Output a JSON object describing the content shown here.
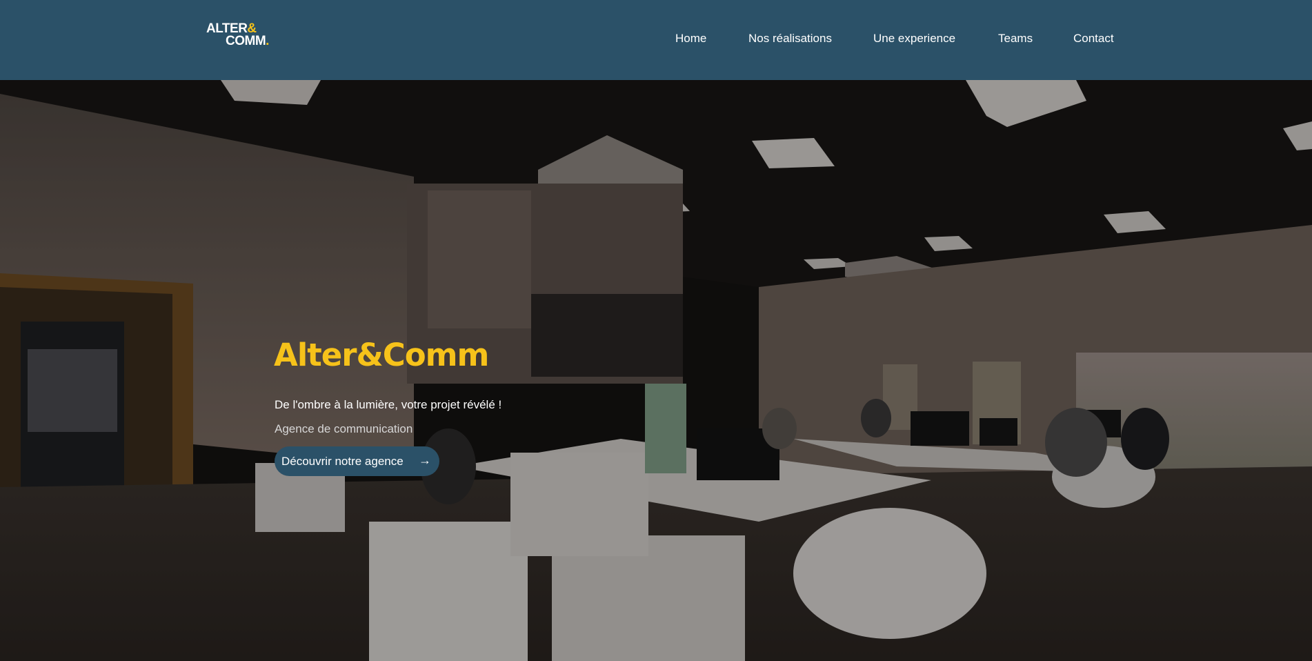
{
  "logo": {
    "line1": "ALTER",
    "amp": "&",
    "line2": "COMM",
    "dot": "."
  },
  "nav": {
    "items": [
      {
        "label": "Home"
      },
      {
        "label": "Nos réalisations"
      },
      {
        "label": "Une experience"
      },
      {
        "label": "Teams"
      },
      {
        "label": "Contact"
      }
    ]
  },
  "hero": {
    "title": "Alter&Comm",
    "tagline": "De l'ombre à la lumière, votre projet révélé !",
    "subtitle": "Agence de communication",
    "cta_label": "Découvrir notre agence",
    "cta_icon": "arrow-right-icon",
    "cta_arrow": "→"
  },
  "colors": {
    "header_bg": "#2b5168",
    "accent_yellow": "#f6c21a",
    "cta_bg": "#2b5168",
    "text_white": "#ffffff"
  }
}
